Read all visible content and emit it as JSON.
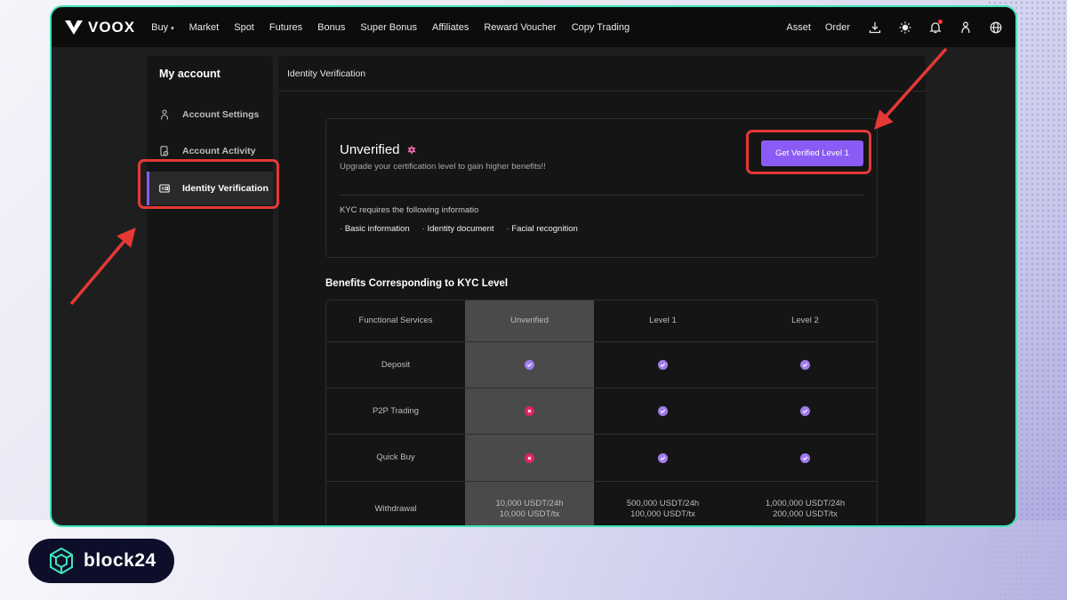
{
  "brand": {
    "logo_text": "VOOX"
  },
  "nav": {
    "items": [
      {
        "label": "Buy",
        "caret": "▾"
      },
      {
        "label": "Market"
      },
      {
        "label": "Spot"
      },
      {
        "label": "Futures"
      },
      {
        "label": "Bonus"
      },
      {
        "label": "Super Bonus"
      },
      {
        "label": "Affiliates"
      },
      {
        "label": "Reward Voucher"
      },
      {
        "label": "Copy Trading"
      }
    ],
    "right": {
      "asset": "Asset",
      "order": "Order"
    },
    "icons": [
      "download-icon",
      "theme-sun-icon",
      "bell-icon",
      "user-icon",
      "globe-icon"
    ]
  },
  "sidebar": {
    "title": "My account",
    "items": [
      {
        "label": "Account Settings",
        "icon": "user-icon"
      },
      {
        "label": "Account Activity",
        "icon": "activity-icon"
      },
      {
        "label": "Identity Verification",
        "icon": "id-card-icon",
        "active": true
      }
    ]
  },
  "main": {
    "header": "Identity Verification",
    "status": {
      "title": "Unverified",
      "subtitle": "Upgrade your certification level to gain higher benefits!!",
      "button": "Get Verified Level 1"
    },
    "kyc": {
      "requirements_label": "KYC requires the following informatio",
      "items": [
        "Basic information",
        "Identity document",
        "Facial recognition"
      ]
    },
    "benefits": {
      "title": "Benefits Corresponding to KYC Level",
      "headers": [
        "Functional Services",
        "Unverified",
        "Level 1",
        "Level 2"
      ],
      "rows": [
        {
          "service": "Deposit",
          "cells": [
            "check",
            "check",
            "check"
          ]
        },
        {
          "service": "P2P Trading",
          "cells": [
            "cross",
            "check",
            "check"
          ]
        },
        {
          "service": "Quick Buy",
          "cells": [
            "cross",
            "check",
            "check"
          ]
        },
        {
          "service": "Withdrawal",
          "limits": [
            [
              "10,000 USDT/24h",
              "10,000 USDT/tx"
            ],
            [
              "500,000 USDT/24h",
              "100,000 USDT/tx"
            ],
            [
              "1,000,000 USDT/24h",
              "200,000 USDT/tx"
            ]
          ]
        }
      ]
    }
  },
  "watermark": {
    "text": "block24"
  },
  "colors": {
    "accent": "#8a5cf5",
    "frame": "#3ee6b8",
    "annotation": "#e53935",
    "check": "#a07cf0",
    "cross": "#e0245e"
  }
}
